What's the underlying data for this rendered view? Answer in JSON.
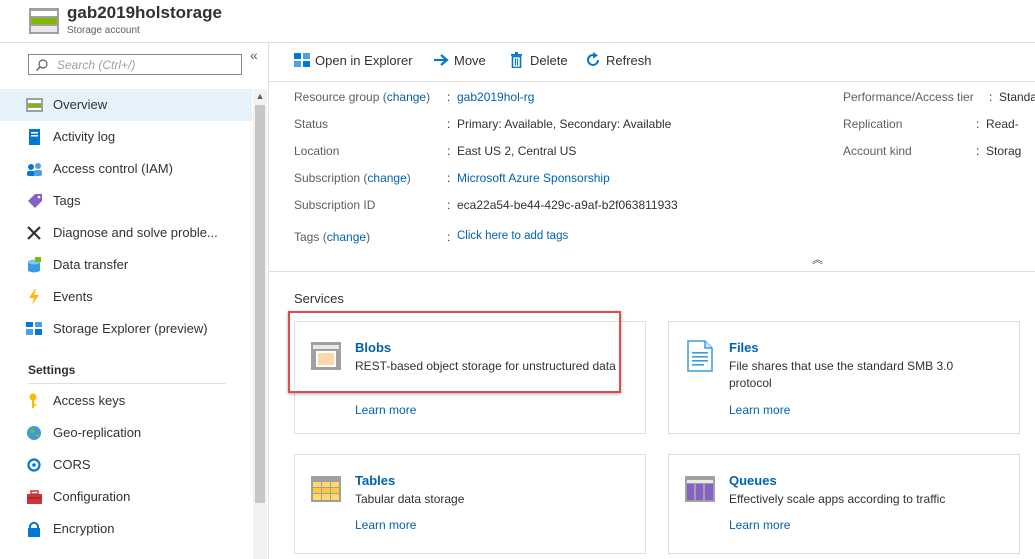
{
  "header": {
    "title": "gab2019holstorage",
    "subtitle": "Storage account",
    "icon": "storage-account-icon"
  },
  "sidebar": {
    "search_placeholder": "Search (Ctrl+/)",
    "collapse_label": "«",
    "items": [
      {
        "label": "Overview",
        "icon": "overview-icon"
      },
      {
        "label": "Activity log",
        "icon": "activity-log-icon"
      },
      {
        "label": "Access control (IAM)",
        "icon": "iam-icon"
      },
      {
        "label": "Tags",
        "icon": "tag-icon"
      },
      {
        "label": "Diagnose and solve proble...",
        "icon": "wrench-icon"
      },
      {
        "label": "Data transfer",
        "icon": "data-transfer-icon"
      },
      {
        "label": "Events",
        "icon": "lightning-icon"
      },
      {
        "label": "Storage Explorer (preview)",
        "icon": "storage-explorer-icon"
      }
    ],
    "settings_header": "Settings",
    "settings_items": [
      {
        "label": "Access keys",
        "icon": "key-icon"
      },
      {
        "label": "Geo-replication",
        "icon": "globe-icon"
      },
      {
        "label": "CORS",
        "icon": "cors-icon"
      },
      {
        "label": "Configuration",
        "icon": "toolbox-icon"
      },
      {
        "label": "Encryption",
        "icon": "lock-icon"
      }
    ]
  },
  "toolbar": {
    "open_explorer": "Open in Explorer",
    "move": "Move",
    "delete": "Delete",
    "refresh": "Refresh"
  },
  "essentials": {
    "resource_group_label": "Resource group",
    "change_link": "change",
    "resource_group_value": "gab2019hol-rg",
    "status_label": "Status",
    "status_value": "Primary: Available, Secondary: Available",
    "location_label": "Location",
    "location_value": "East US 2, Central US",
    "subscription_label": "Subscription",
    "subscription_value": "Microsoft Azure Sponsorship",
    "subscription_id_label": "Subscription ID",
    "subscription_id_value": "eca22a54-be44-429c-a9af-b2f063811933",
    "tags_label": "Tags",
    "tags_value": "Click here to add tags",
    "perf_label": "Performance/Access tier",
    "perf_value": "Standa",
    "replication_label": "Replication",
    "replication_value": "Read-",
    "account_kind_label": "Account kind",
    "account_kind_value": "Storag"
  },
  "services": {
    "header": "Services",
    "learn_more": "Learn more",
    "cards": [
      {
        "title": "Blobs",
        "desc": "REST-based object storage for unstructured data",
        "icon": "blob-icon"
      },
      {
        "title": "Files",
        "desc": "File shares that use the standard SMB 3.0 protocol",
        "icon": "file-icon"
      },
      {
        "title": "Tables",
        "desc": "Tabular data storage",
        "icon": "table-icon"
      },
      {
        "title": "Queues",
        "desc": "Effectively scale apps according to traffic",
        "icon": "queue-icon"
      }
    ]
  },
  "colors": {
    "link": "#0062ad",
    "highlight": "#e04b4b",
    "active_nav": "#e5f1fb"
  }
}
